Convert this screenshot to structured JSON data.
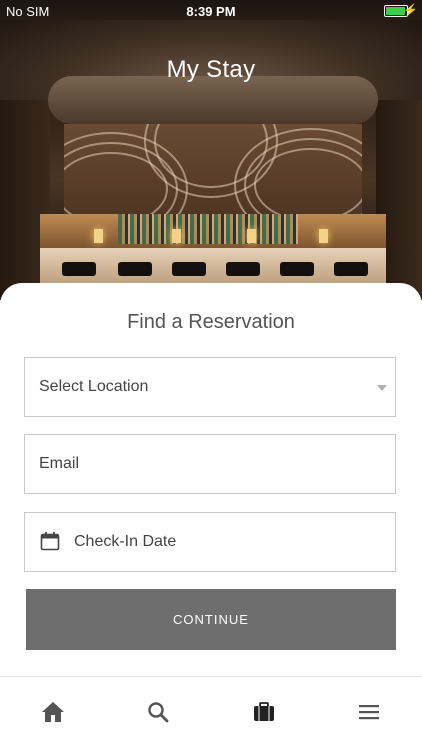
{
  "status_bar": {
    "carrier": "No SIM",
    "time": "8:39 PM",
    "battery_level": 0.95,
    "battery_color": "#3ad14a"
  },
  "header": {
    "title": "My Stay",
    "background_image": "hotel-bar-photo"
  },
  "form": {
    "heading": "Find a Reservation",
    "location_select": {
      "placeholder": "Select Location"
    },
    "email_field": {
      "placeholder": "Email"
    },
    "checkin_field": {
      "placeholder": "Check-In Date",
      "icon": "calendar-icon"
    },
    "continue_button": {
      "label": "CONTINUE",
      "color": "#6e6e6e"
    }
  },
  "tab_bar": {
    "items": [
      {
        "icon": "home-icon",
        "selected": false
      },
      {
        "icon": "search-icon",
        "selected": false
      },
      {
        "icon": "briefcase-icon",
        "selected": true
      },
      {
        "icon": "menu-icon",
        "selected": false
      }
    ]
  }
}
